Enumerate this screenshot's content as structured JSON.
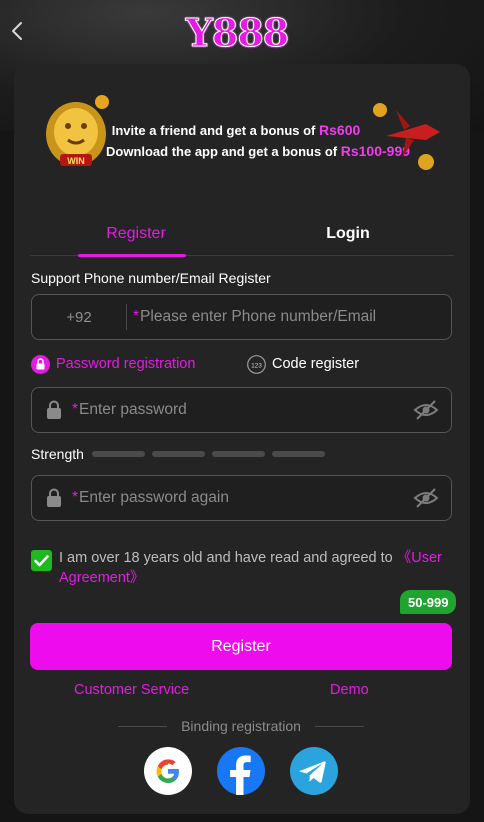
{
  "brand": {
    "logo_text": "Y888",
    "accent": "#e51ae5",
    "success": "#1fb81f"
  },
  "header": {
    "back_icon": "chevron-left-icon"
  },
  "banner": {
    "line1_prefix": "Invite a friend and get a bonus of",
    "line1_amount": "Rs600",
    "line2_prefix": "Download the app and get a bonus of",
    "line2_amount": "Rs100-999",
    "lion_badge": "WIN"
  },
  "tabs": [
    {
      "label": "Register",
      "active": true
    },
    {
      "label": "Login",
      "active": false
    }
  ],
  "form": {
    "support_label": "Support Phone number/Email Register",
    "country_code": "+92",
    "phone_placeholder": "Please enter Phone number/Email",
    "required_mark": "*",
    "mode_password": "Password registration",
    "mode_code": "Code register",
    "mode_code_icon_text": "123",
    "password_placeholder": "Enter password",
    "strength_label": "Strength",
    "strength_level": 0,
    "password_again_placeholder": "Enter password again",
    "agree_checked": true,
    "agree_text": "I am over 18 years old and have read and agreed to ",
    "agree_link": "《User Agreement》",
    "bonus_badge": "50-999",
    "register_button": "Register"
  },
  "footer": {
    "customer_service": "Customer Service",
    "demo": "Demo",
    "binding_label": "Binding registration",
    "social": [
      "google-icon",
      "facebook-icon",
      "telegram-icon"
    ]
  }
}
